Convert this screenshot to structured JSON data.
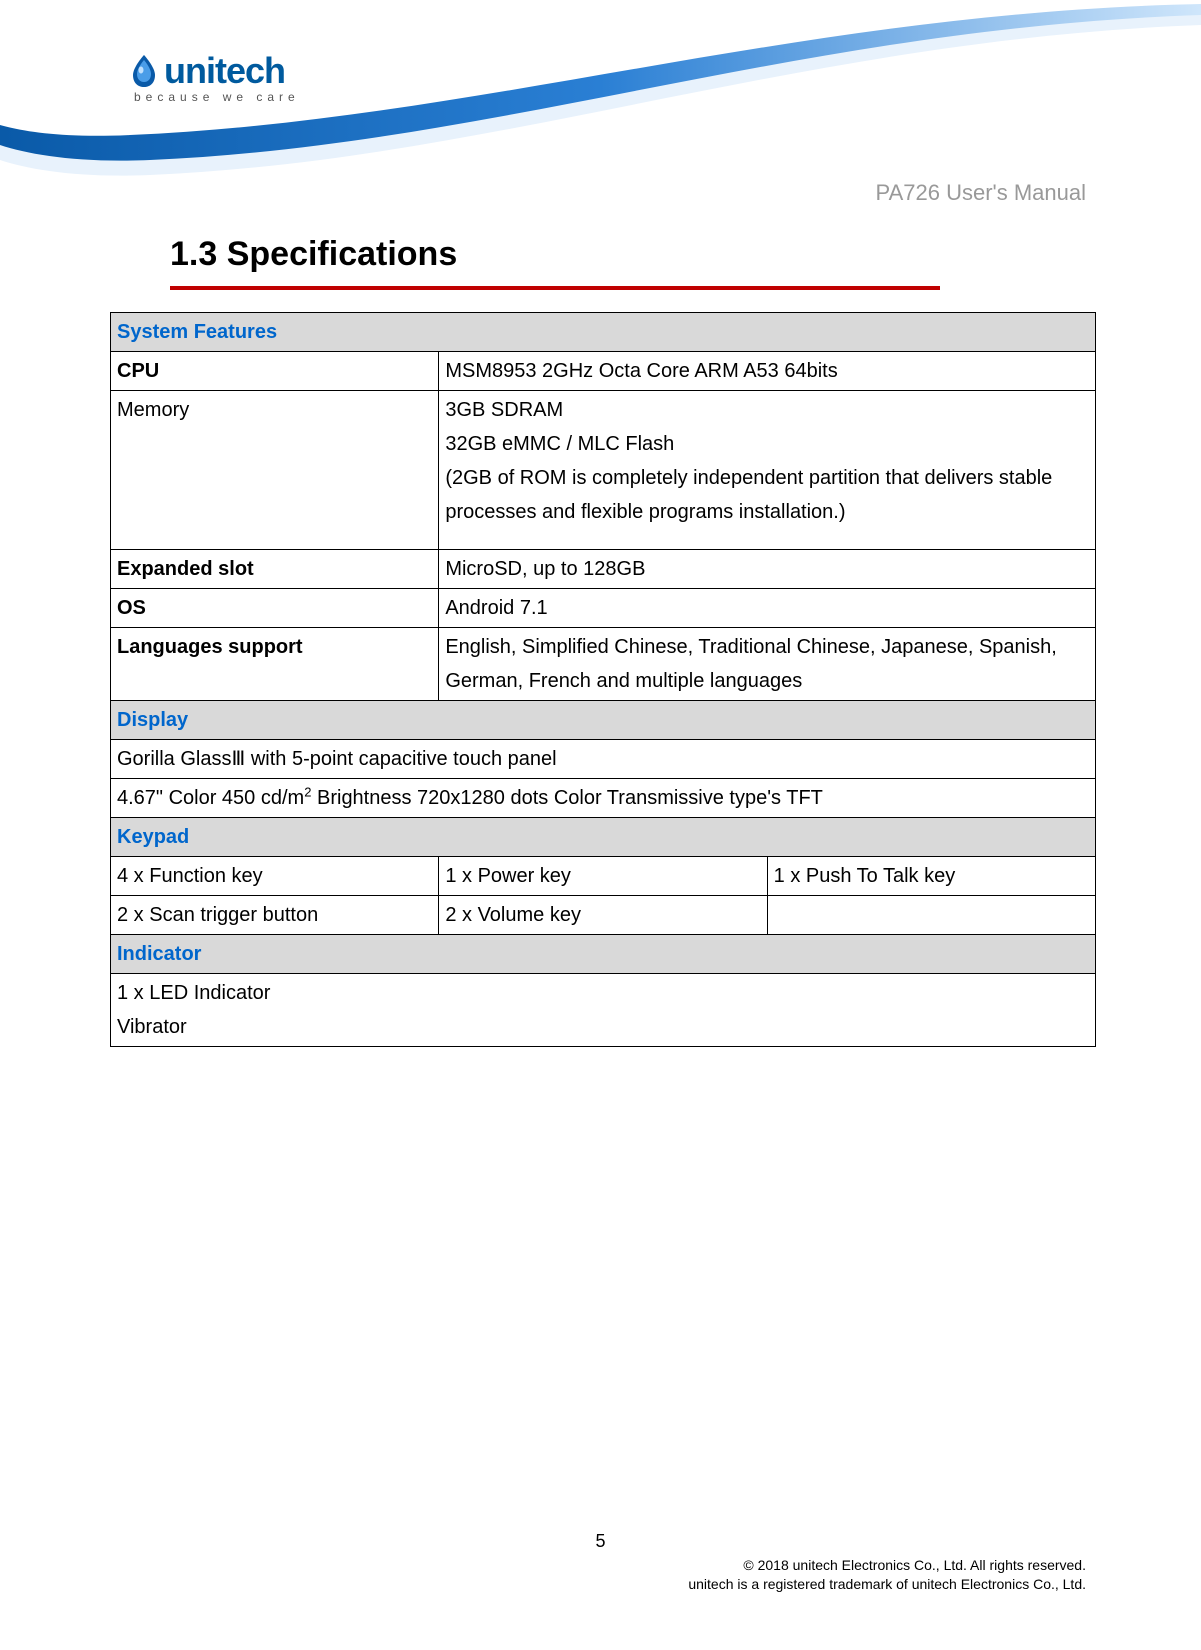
{
  "logo": {
    "name": "unitech",
    "tagline": "because we care"
  },
  "doc_title": "PA726 User's Manual",
  "section": {
    "heading": "1.3 Specifications"
  },
  "spec_table": {
    "system_features": {
      "header": "System Features",
      "cpu": {
        "label": "CPU",
        "value": "MSM8953 2GHz Octa Core ARM A53 64bits"
      },
      "memory": {
        "label": "Memory",
        "line1": "3GB SDRAM",
        "line2": "32GB eMMC / MLC Flash",
        "line3": "(2GB of ROM is completely independent partition that delivers stable processes and flexible programs installation.)"
      },
      "expanded_slot": {
        "label": "Expanded slot",
        "value": "MicroSD, up to 128GB"
      },
      "os": {
        "label": "OS",
        "value": "Android 7.1"
      },
      "languages": {
        "label": "Languages support",
        "value": "English, Simplified Chinese, Traditional Chinese, Japanese, Spanish, German, French and multiple languages"
      }
    },
    "display": {
      "header": "Display",
      "row1": "Gorilla GlassⅢ with 5-point capacitive touch panel",
      "row2_prefix": "4.67\" Color 450 cd/m",
      "row2_sup": "2",
      "row2_suffix": " Brightness 720x1280 dots Color Transmissive type's TFT"
    },
    "keypad": {
      "header": "Keypad",
      "r1c1": "4 x Function key",
      "r1c2": "1 x Power key",
      "r1c3": "1 x Push To Talk key",
      "r2c1": "2 x Scan trigger button",
      "r2c2": "2 x Volume key",
      "r2c3": ""
    },
    "indicator": {
      "header": "Indicator",
      "line1": "1 x LED Indicator",
      "line2": "Vibrator"
    }
  },
  "footer": {
    "page": "5",
    "copyright1": "© 2018 unitech Electronics Co., Ltd. All rights reserved.",
    "copyright2": "unitech is a registered trademark of unitech Electronics Co., Ltd."
  }
}
